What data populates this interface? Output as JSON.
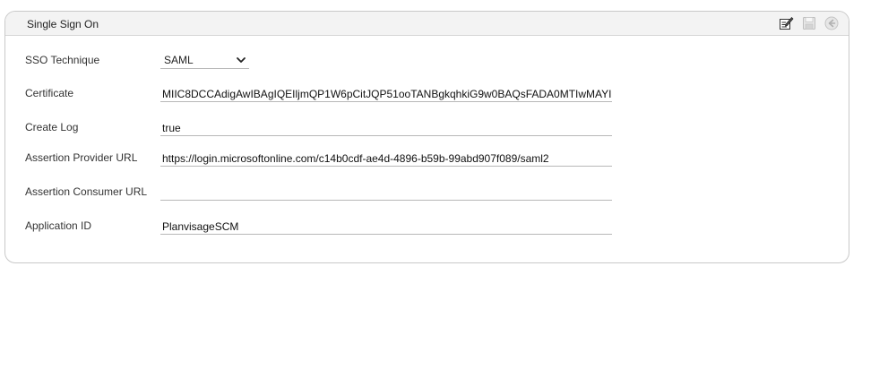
{
  "panel": {
    "title": "Single Sign On",
    "toolbar": {
      "edit_icon": "edit-form-icon",
      "save_icon": "save-disk-icon",
      "back_icon": "back-arrow-icon"
    }
  },
  "form": {
    "sso_technique": {
      "label": "SSO Technique",
      "value": "SAML"
    },
    "certificate": {
      "label": "Certificate",
      "value": "MIIC8DCCAdigAwIBAgIQEIljmQP1W6pCitJQP51ooTANBgkqhkiG9w0BAQsFADA0MTIwMAYI"
    },
    "create_log": {
      "label": "Create Log",
      "value": "true"
    },
    "assertion_provider_url": {
      "label": "Assertion Provider URL",
      "value": "https://login.microsoftonline.com/c14b0cdf-ae4d-4896-b59b-99abd907f089/saml2"
    },
    "assertion_consumer_url": {
      "label": "Assertion Consumer URL",
      "value": ""
    },
    "application_id": {
      "label": "Application ID",
      "value": "PlanvisageSCM"
    }
  }
}
